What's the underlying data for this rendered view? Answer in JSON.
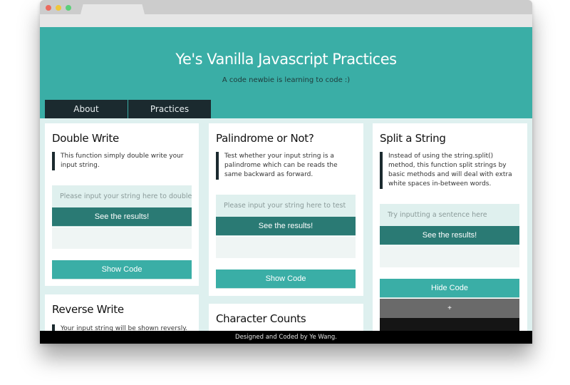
{
  "browser": {
    "controls": [
      "close",
      "minimize",
      "maximize"
    ]
  },
  "header": {
    "title": "Ye's Vanilla Javascript Practices",
    "subtitle": "A code newbie is learning to code :)"
  },
  "nav": {
    "items": [
      {
        "label": "About"
      },
      {
        "label": "Practices"
      }
    ]
  },
  "cards": [
    {
      "title": "Double Write",
      "description": "This function simply double write your input string.",
      "input_placeholder": "Please input your string here to double it",
      "results_label": "See the results!",
      "code_button_label": "Show Code"
    },
    {
      "title": "Reverse Write",
      "description": "Your input string will be shown reversly."
    },
    {
      "title": "Palindrome or Not?",
      "description": "Test whether your input string is a palindrome which can be reads the same backward as forward.",
      "input_placeholder": "Please input your string here to test",
      "results_label": "See the results!",
      "code_button_label": "Show Code"
    },
    {
      "title": "Character Counts"
    },
    {
      "title": "Split a String",
      "description": "Instead of using the string.split() method, this function split strings by basic methods and will deal with extra white spaces in-between words.",
      "input_placeholder": "Try inputting a sentence here",
      "results_label": "See the results!",
      "code_button_label": "Hide Code",
      "code_toggle_label": "+"
    }
  ],
  "footer": {
    "text": "Designed and Coded by Ye Wang."
  },
  "colors": {
    "primary": "#3aaea6",
    "primary_dark": "#2a7a74",
    "nav_bg": "#1b2a2f",
    "page_bg": "#def0ef",
    "footer_bg": "#000000"
  }
}
